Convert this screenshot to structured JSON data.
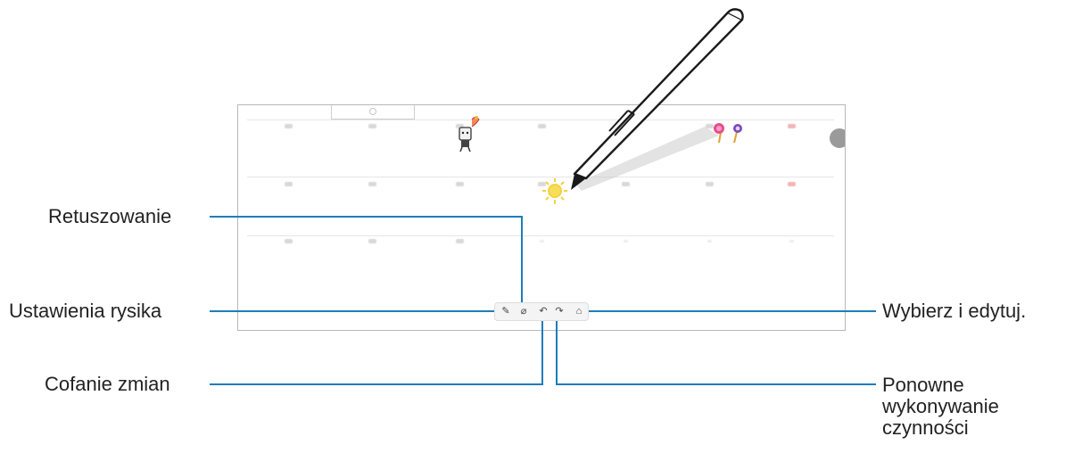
{
  "callouts": {
    "retouch": "Retuszowanie",
    "pen_settings": "Ustawienia rysika",
    "undo": "Cofanie zmian",
    "select_edit": "Wybierz i edytuj.",
    "redo": "Ponowne wykonywanie czynności"
  },
  "toolbar": {
    "pen_settings_icon": "pen-icon",
    "retouch_icon": "eraser-icon",
    "undo_icon": "undo-icon",
    "redo_icon": "redo-icon",
    "select_icon": "lasso-icon",
    "pen_glyph": "✎",
    "retouch_glyph": "⌀",
    "undo_glyph": "↶",
    "redo_glyph": "↷",
    "select_glyph": "⌂"
  },
  "colors": {
    "leader_line": "#1e7dbb",
    "pen_body": "#ffffff",
    "pen_outline": "#1a1a1a",
    "sun": "#f4d23c",
    "accent_red": "#e05a5a"
  }
}
